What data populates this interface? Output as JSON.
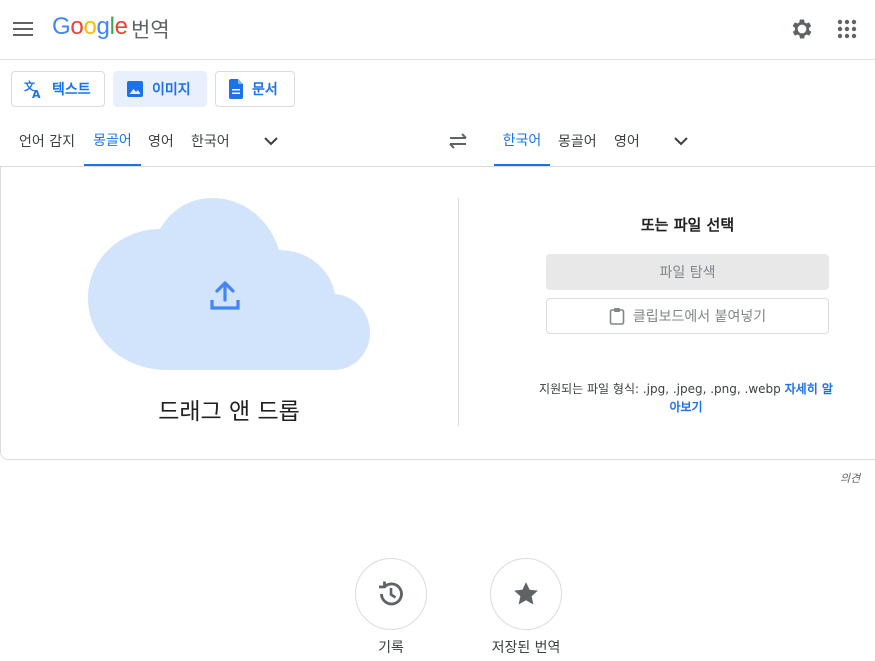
{
  "header": {
    "logo_letters": [
      "G",
      "o",
      "o",
      "g",
      "l",
      "e"
    ],
    "app_name": "번역"
  },
  "modes": {
    "text_label": "텍스트",
    "image_label": "이미지",
    "document_label": "문서",
    "active": "image"
  },
  "source_langs": [
    "언어 감지",
    "몽골어",
    "영어",
    "한국어"
  ],
  "source_active": "몽골어",
  "target_langs": [
    "한국어",
    "몽골어",
    "영어"
  ],
  "target_active": "한국어",
  "upload": {
    "drop_label": "드래그 앤 드롭",
    "or_label": "또는 파일 선택",
    "browse_label": "파일 탐색",
    "paste_label": "클립보드에서 붙여넣기",
    "formats_text": "지원되는 파일 형식: .jpg, .jpeg, .png, .webp",
    "learn_more_line1": "자세히 알",
    "learn_more_line2": "아보기"
  },
  "feedback_label": "의견",
  "bottom": {
    "history_label": "기록",
    "saved_label": "저장된 번역"
  },
  "colors": {
    "accent": "#1a73e8",
    "cloud": "#d2e3fc",
    "upload_icon": "#4285f4"
  }
}
